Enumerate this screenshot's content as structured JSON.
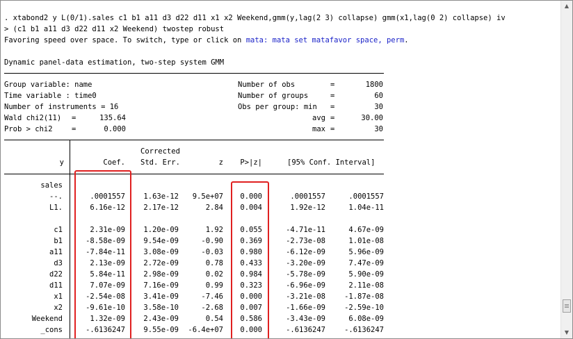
{
  "command": {
    "line1": ". xtabond2 y L(0/1).sales c1 b1 a11 d3 d22 d11 x1 x2 Weekend,gmm(y,lag(2 3) collapse) gmm(x1,lag(0 2) collapse) iv",
    "line2": "> (c1 b1 a11 d3 d22 d11 x2 Weekend) twostep robust"
  },
  "notice": {
    "text": "Favoring speed over space. To switch, type or click on ",
    "link": "mata: mata set matafavor space, perm",
    "suffix": "."
  },
  "estimation_title": "Dynamic panel-data estimation, two-step system GMM",
  "summary": {
    "group_variable": "Group variable: name",
    "time_variable": "Time variable : time0",
    "num_instruments": "Number of instruments = 16",
    "wald_label": "Wald chi2(11)",
    "wald_value": "135.64",
    "prob_label": "Prob > chi2",
    "prob_value": "0.000",
    "nobs_label": "Number of obs",
    "nobs_value": "1800",
    "ngroups_label": "Number of groups",
    "ngroups_value": "60",
    "opg_label": "Obs per group: min",
    "opg_min": "30",
    "avg_label": "avg",
    "avg_value": "30.00",
    "max_label": "max",
    "max_value": "30"
  },
  "table": {
    "header": {
      "y": "y",
      "coef": "Coef.",
      "corrected": "Corrected",
      "stderr": "Std. Err.",
      "z": "z",
      "p": "P>|z|",
      "ci": "[95% Conf. Interval]"
    },
    "group_label": "sales",
    "rows": [
      {
        "var": "--.",
        "coef": ".0001557",
        "se": "1.63e-12",
        "z": "9.5e+07",
        "p": "0.000",
        "lo": ".0001557",
        "hi": ".0001557"
      },
      {
        "var": "L1.",
        "coef": "6.16e-12",
        "se": "2.17e-12",
        "z": "2.84",
        "p": "0.004",
        "lo": "1.92e-12",
        "hi": "1.04e-11"
      },
      {
        "var": "c1",
        "coef": "2.31e-09",
        "se": "1.20e-09",
        "z": "1.92",
        "p": "0.055",
        "lo": "-4.71e-11",
        "hi": "4.67e-09"
      },
      {
        "var": "b1",
        "coef": "-8.58e-09",
        "se": "9.54e-09",
        "z": "-0.90",
        "p": "0.369",
        "lo": "-2.73e-08",
        "hi": "1.01e-08"
      },
      {
        "var": "a11",
        "coef": "-7.84e-11",
        "se": "3.08e-09",
        "z": "-0.03",
        "p": "0.980",
        "lo": "-6.12e-09",
        "hi": "5.96e-09"
      },
      {
        "var": "d3",
        "coef": "2.13e-09",
        "se": "2.72e-09",
        "z": "0.78",
        "p": "0.433",
        "lo": "-3.20e-09",
        "hi": "7.47e-09"
      },
      {
        "var": "d22",
        "coef": "5.84e-11",
        "se": "2.98e-09",
        "z": "0.02",
        "p": "0.984",
        "lo": "-5.78e-09",
        "hi": "5.90e-09"
      },
      {
        "var": "d11",
        "coef": "7.07e-09",
        "se": "7.16e-09",
        "z": "0.99",
        "p": "0.323",
        "lo": "-6.96e-09",
        "hi": "2.11e-08"
      },
      {
        "var": "x1",
        "coef": "-2.54e-08",
        "se": "3.41e-09",
        "z": "-7.46",
        "p": "0.000",
        "lo": "-3.21e-08",
        "hi": "-1.87e-08"
      },
      {
        "var": "x2",
        "coef": "-9.61e-10",
        "se": "3.58e-10",
        "z": "-2.68",
        "p": "0.007",
        "lo": "-1.66e-09",
        "hi": "-2.59e-10"
      },
      {
        "var": "Weekend",
        "coef": "1.32e-09",
        "se": "2.43e-09",
        "z": "0.54",
        "p": "0.586",
        "lo": "-3.43e-09",
        "hi": "6.08e-09"
      },
      {
        "var": "_cons",
        "coef": "-.6136247",
        "se": "9.55e-09",
        "z": "-6.4e+07",
        "p": "0.000",
        "lo": "-.6136247",
        "hi": "-.6136247"
      }
    ]
  },
  "colors": {
    "highlight_box": "#e02020",
    "link": "#1a22c8"
  },
  "icons": {
    "scroll_up": "scroll-up-arrow-icon",
    "scroll_down": "scroll-down-arrow-icon"
  }
}
